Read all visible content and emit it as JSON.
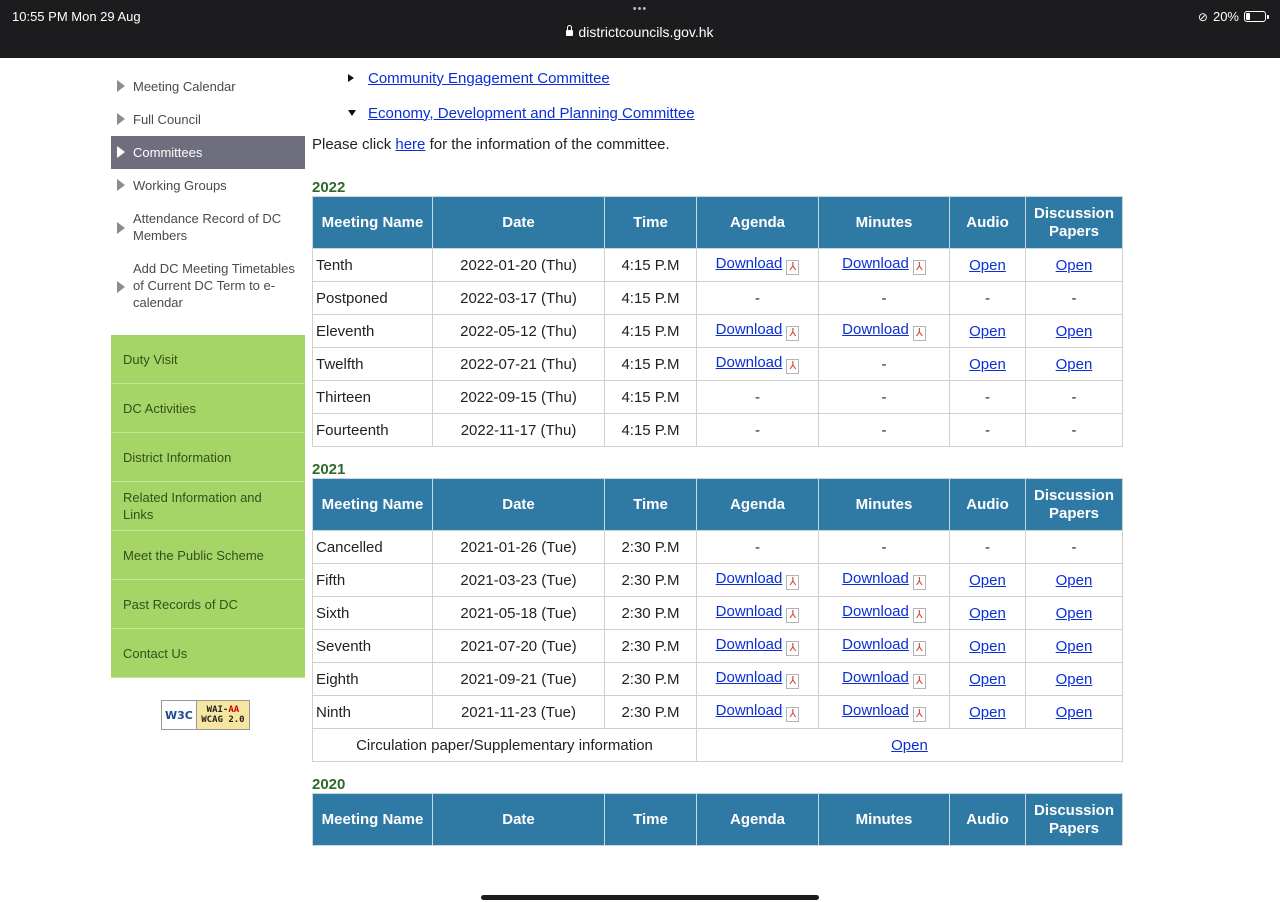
{
  "status": {
    "time": "10:55 PM  Mon 29 Aug",
    "dots": "•••",
    "url": "districtcouncils.gov.hk",
    "battery": "20%"
  },
  "sidebar": {
    "items": [
      {
        "label": "Meeting Calendar"
      },
      {
        "label": "Full Council"
      },
      {
        "label": "Committees"
      },
      {
        "label": "Working Groups"
      },
      {
        "label": "Attendance Record of DC Members"
      },
      {
        "label": "Add DC Meeting Timetables of Current DC Term to e-calendar"
      }
    ],
    "green": [
      "Duty Visit",
      "DC Activities",
      "District Information",
      "Related Information and Links",
      "Meet the Public Scheme",
      "Past Records of DC",
      "Contact Us"
    ]
  },
  "badge": {
    "w3c": "W3C",
    "line1_a": "WAI-",
    "line1_b": "AA",
    "line2": "WCAG 2.0"
  },
  "main": {
    "comm1": "Community Engagement Committee",
    "comm2": "Economy, Development and Planning Committee",
    "note_pre": "Please click ",
    "note_link": "here",
    "note_post": " for the information of the committee.",
    "headers": [
      "Meeting Name",
      "Date",
      "Time",
      "Agenda",
      "Minutes",
      "Audio",
      "Discussion Papers"
    ]
  },
  "tables": {
    "y2022": {
      "year": "2022",
      "rows": [
        [
          "Tenth",
          "2022-01-20 (Thu)",
          "4:15 P.M",
          "Download",
          "Download",
          "Open",
          "Open"
        ],
        [
          "Postponed",
          "2022-03-17 (Thu)",
          "4:15 P.M",
          "-",
          "-",
          "-",
          "-"
        ],
        [
          "Eleventh",
          "2022-05-12 (Thu)",
          "4:15 P.M",
          "Download",
          "Download",
          "Open",
          "Open"
        ],
        [
          "Twelfth",
          "2022-07-21 (Thu)",
          "4:15 P.M",
          "Download",
          "-",
          "Open",
          "Open"
        ],
        [
          "Thirteen",
          "2022-09-15 (Thu)",
          "4:15 P.M",
          "-",
          "-",
          "-",
          "-"
        ],
        [
          "Fourteenth",
          "2022-11-17 (Thu)",
          "4:15 P.M",
          "-",
          "-",
          "-",
          "-"
        ]
      ]
    },
    "y2021": {
      "year": "2021",
      "rows": [
        [
          "Cancelled",
          "2021-01-26 (Tue)",
          "2:30 P.M",
          "-",
          "-",
          "-",
          "-"
        ],
        [
          "Fifth",
          "2021-03-23 (Tue)",
          "2:30 P.M",
          "Download",
          "Download",
          "Open",
          "Open"
        ],
        [
          "Sixth",
          "2021-05-18 (Tue)",
          "2:30 P.M",
          "Download",
          "Download",
          "Open",
          "Open"
        ],
        [
          "Seventh",
          "2021-07-20 (Tue)",
          "2:30 P.M",
          "Download",
          "Download",
          "Open",
          "Open"
        ],
        [
          "Eighth",
          "2021-09-21 (Tue)",
          "2:30 P.M",
          "Download",
          "Download",
          "Open",
          "Open"
        ],
        [
          "Ninth",
          "2021-11-23 (Tue)",
          "2:30 P.M",
          "Download",
          "Download",
          "Open",
          "Open"
        ]
      ],
      "circ_label": "Circulation paper/Supplementary information",
      "circ_link": "Open"
    },
    "y2020": {
      "year": "2020",
      "rows": []
    }
  }
}
